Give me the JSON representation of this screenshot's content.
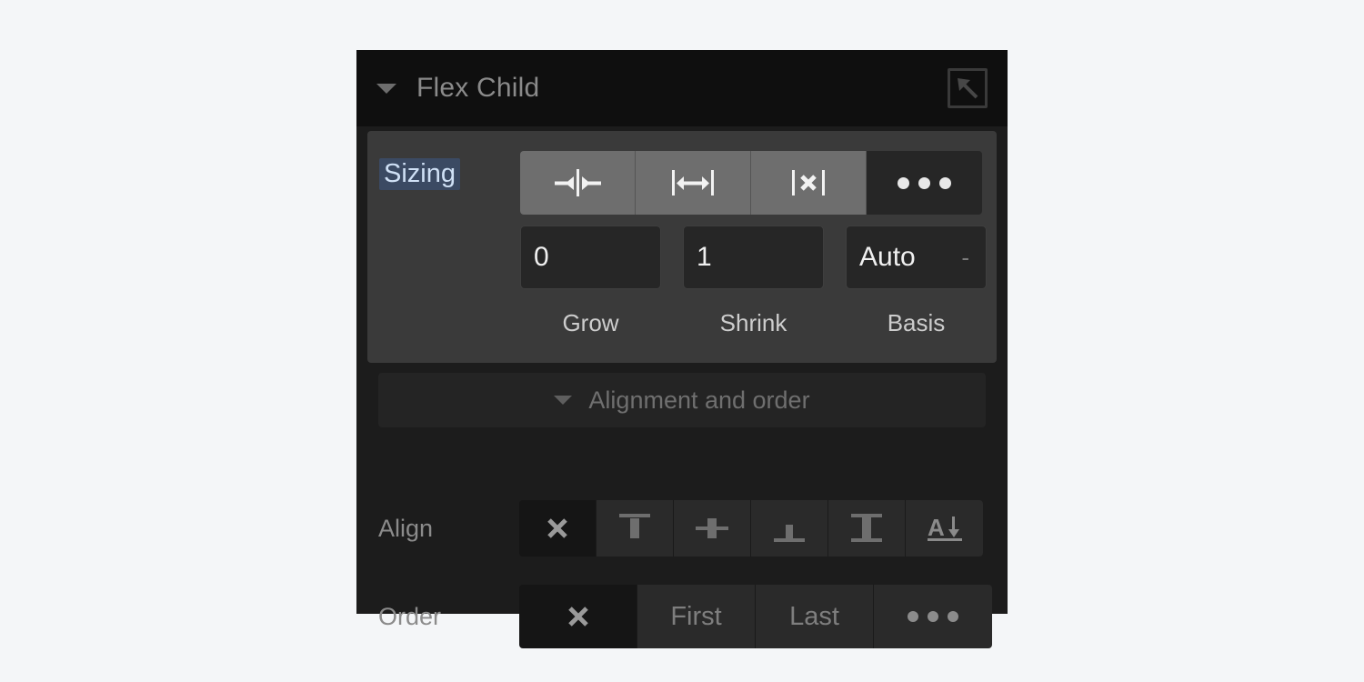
{
  "panel": {
    "title": "Flex Child",
    "collapse_icon": "caret-down-icon",
    "parent_select_icon": "arrow-up-left-in-square-icon"
  },
  "sizing": {
    "label": "Sizing",
    "label_selected": true,
    "selection_highlight_color": "#3b4a63",
    "selection_text_color": "#cfe0f5",
    "mode_buttons": [
      {
        "name": "shrink-if-needed",
        "icon": "arrows-inward-icon",
        "state": "hover"
      },
      {
        "name": "grow-if-possible",
        "icon": "arrows-outward-icon",
        "state": "hover"
      },
      {
        "name": "no-sizing",
        "icon": "x-between-bars-icon",
        "state": "hover"
      },
      {
        "name": "more-options",
        "icon": "ellipsis-icon",
        "state": "normal"
      }
    ],
    "fields": [
      {
        "caption": "Grow",
        "value": "0",
        "unit": ""
      },
      {
        "caption": "Shrink",
        "value": "1",
        "unit": ""
      },
      {
        "caption": "Basis",
        "value": "Auto",
        "unit": "-"
      }
    ]
  },
  "alignment_section": {
    "title": "Alignment and order",
    "collapse_icon": "caret-down-icon"
  },
  "align": {
    "label": "Align",
    "buttons": [
      {
        "name": "align-auto",
        "icon": "x-icon",
        "selected": true
      },
      {
        "name": "align-start",
        "icon": "align-start-icon",
        "selected": false
      },
      {
        "name": "align-center",
        "icon": "align-center-icon",
        "selected": false
      },
      {
        "name": "align-end",
        "icon": "align-end-icon",
        "selected": false
      },
      {
        "name": "align-stretch",
        "icon": "align-stretch-icon",
        "selected": false
      },
      {
        "name": "align-baseline",
        "icon": "baseline-a-arrow-icon",
        "selected": false
      }
    ]
  },
  "order": {
    "label": "Order",
    "buttons": [
      {
        "name": "order-none",
        "label": "",
        "icon": "x-icon",
        "selected": true
      },
      {
        "name": "order-first",
        "label": "First",
        "icon": "",
        "selected": false
      },
      {
        "name": "order-last",
        "label": "Last",
        "icon": "",
        "selected": false
      },
      {
        "name": "order-more",
        "label": "",
        "icon": "ellipsis-icon",
        "selected": false
      }
    ]
  },
  "colors": {
    "page_background": "#f4f6f8",
    "panel_background": "#1c1c1c",
    "header_background": "#0f0f0f",
    "sizing_block_background": "#3a3a3a",
    "button_background": "#2a2a2a",
    "button_active_background": "#151515",
    "segment_hover_background": "#6e6e6e",
    "field_background": "#262626",
    "text_muted": "#8b8b8b",
    "text_bright": "#f0f0f0"
  }
}
